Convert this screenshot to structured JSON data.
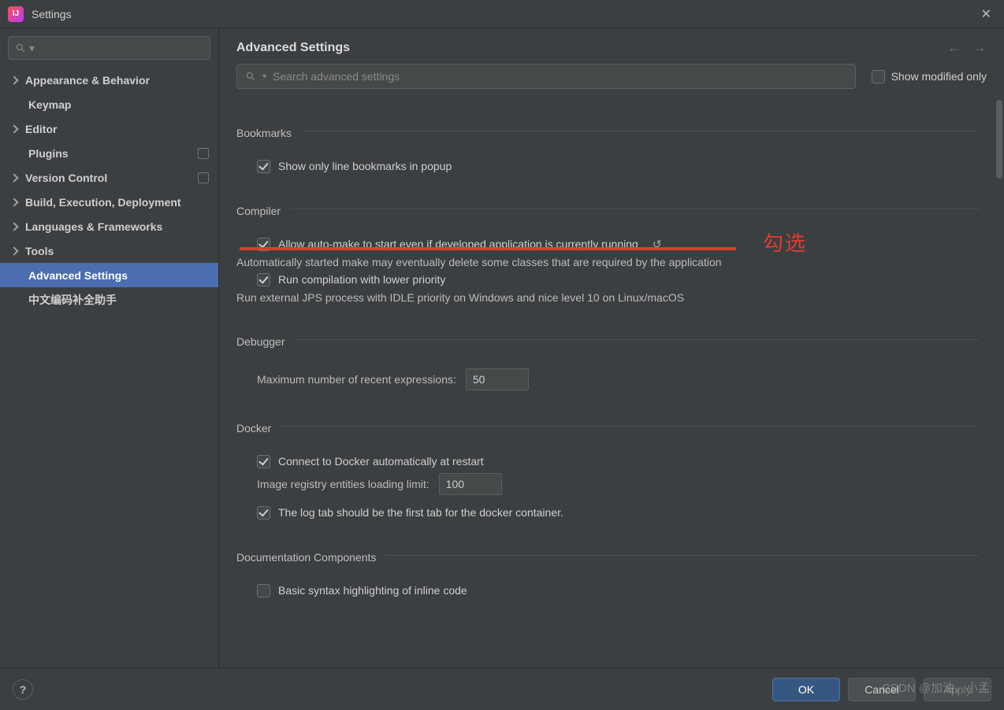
{
  "window": {
    "title": "Settings"
  },
  "sidebar": {
    "items": [
      {
        "label": "Appearance & Behavior",
        "expandable": true
      },
      {
        "label": "Keymap"
      },
      {
        "label": "Editor",
        "expandable": true
      },
      {
        "label": "Plugins",
        "tag": true
      },
      {
        "label": "Version Control",
        "expandable": true,
        "tag": true
      },
      {
        "label": "Build, Execution, Deployment",
        "expandable": true
      },
      {
        "label": "Languages & Frameworks",
        "expandable": true
      },
      {
        "label": "Tools",
        "expandable": true
      },
      {
        "label": "Advanced Settings",
        "selected": true
      },
      {
        "label": "中文编码补全助手"
      }
    ]
  },
  "header": {
    "title": "Advanced Settings",
    "search_placeholder": "Search advanced settings",
    "show_modified_only": "Show modified only"
  },
  "sections": {
    "bookmarks": {
      "title": "Bookmarks",
      "show_only_line": "Show only line bookmarks in popup"
    },
    "compiler": {
      "title": "Compiler",
      "allow_auto_make": "Allow auto-make to start even if developed application is currently running",
      "allow_auto_make_sub": "Automatically started make may eventually delete some classes that are required by the application",
      "lower_priority": "Run compilation with lower priority",
      "lower_priority_sub": "Run external JPS process with IDLE priority on Windows and nice level 10 on Linux/macOS"
    },
    "debugger": {
      "title": "Debugger",
      "max_expr_label": "Maximum number of recent expressions:",
      "max_expr_value": "50"
    },
    "docker": {
      "title": "Docker",
      "connect_auto": "Connect to Docker automatically at restart",
      "registry_label": "Image registry entities loading limit:",
      "registry_value": "100",
      "log_first": "The log tab should be the first tab for the docker container."
    },
    "doc_components": {
      "title": "Documentation Components",
      "basic_syntax": "Basic syntax highlighting of inline code"
    }
  },
  "annotation": {
    "text": "勾选"
  },
  "footer": {
    "ok": "OK",
    "cancel": "Cancel",
    "apply": "Apply"
  },
  "watermark": "CSDN @加油，小孟"
}
